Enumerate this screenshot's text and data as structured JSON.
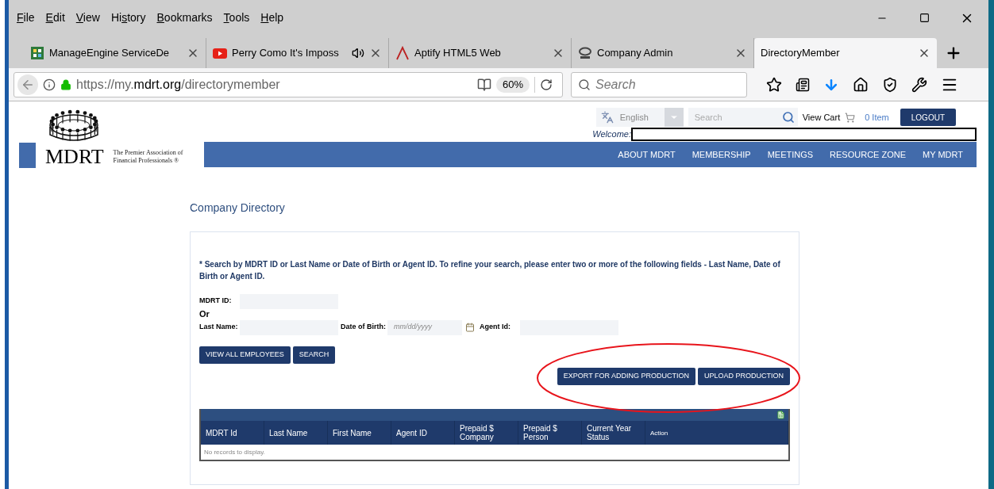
{
  "menu_bar": [
    {
      "label": "File"
    },
    {
      "label": "Edit"
    },
    {
      "label": "View"
    },
    {
      "label": "History"
    },
    {
      "label": "Bookmarks"
    },
    {
      "label": "Tools"
    },
    {
      "label": "Help"
    }
  ],
  "tabs": [
    {
      "title": "ManageEngine ServiceDe",
      "kind": "grid",
      "audio": false,
      "selected": false
    },
    {
      "title": "Perry Como It's Imposs",
      "kind": "video",
      "audio": true,
      "selected": false
    },
    {
      "title": "Aptify HTML5 Web",
      "kind": "mark",
      "audio": false,
      "selected": false
    },
    {
      "title": "Company Admin",
      "kind": "round",
      "audio": false,
      "selected": false
    },
    {
      "title": "DirectoryMember",
      "kind": "plain",
      "audio": false,
      "selected": true
    }
  ],
  "address_bar": {
    "url_prefix": "https://my.",
    "url_domain": "mdrt.org",
    "url_path": "/directorymember",
    "zoom": "60%"
  },
  "browser_search": {
    "placeholder": "Search"
  },
  "site": {
    "logo_text": "MDRT",
    "tagline_1": "The Premier Association of",
    "tagline_2": "Financial Professionals ®",
    "language": "English",
    "search_placeholder": "Search",
    "view_cart": "View Cart",
    "cart_count": "0 Item",
    "logout": "LOGOUT",
    "welcome": "Welcome:",
    "nav": [
      "ABOUT MDRT",
      "MEMBERSHIP",
      "MEETINGS",
      "RESOURCE ZONE",
      "MY MDRT"
    ]
  },
  "page_title": "Company Directory",
  "form": {
    "note": "* Search by MDRT ID or Last Name or Date of Birth or Agent ID. To refine your search, please enter two or more of the following fields - Last Name, Date of Birth or Agent ID.",
    "mdrt_id_label": "MDRT ID:",
    "or_label": "Or",
    "last_name_label": "Last Name:",
    "dob_label": "Date of Birth:",
    "dob_placeholder": "mm/dd/yyyy",
    "agent_id_label": "Agent Id:",
    "buttons": [
      "VIEW ALL EMPLOYEES",
      "SEARCH"
    ],
    "export_buttons": [
      "EXPORT FOR ADDING PRODUCTION",
      "UPLOAD PRODUCTION"
    ]
  },
  "table": {
    "columns": [
      "MDRT Id",
      "Last Name",
      "First Name",
      "Agent ID",
      "Prepaid $ Company",
      "Prepaid $ Person",
      "Current Year Status",
      "Action"
    ],
    "empty_message": "No records to display."
  }
}
